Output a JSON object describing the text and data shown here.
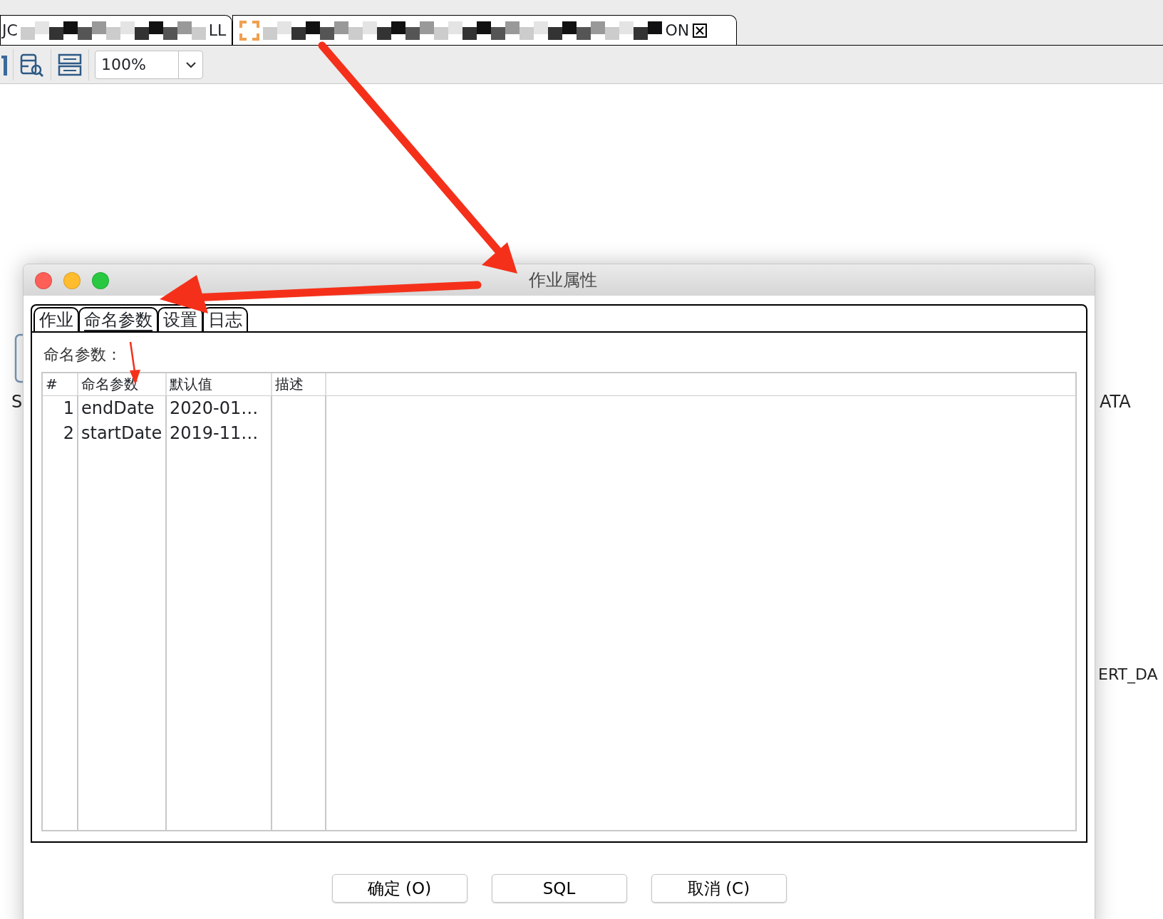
{
  "editor_tabs": [
    {
      "label_start": "JC",
      "label_end": "LL"
    },
    {
      "label_end": "ON"
    }
  ],
  "toolbar": {
    "zoom": "100%"
  },
  "canvas_labels": [
    "S",
    "ATA",
    "ERT_DA"
  ],
  "dialog": {
    "title": "作业属性",
    "tabs": [
      {
        "label": "作业",
        "selected": false
      },
      {
        "label": "命名参数",
        "selected": true
      },
      {
        "label": "设置",
        "selected": false
      },
      {
        "label": "日志",
        "selected": false
      }
    ],
    "section_label": "命名参数：",
    "table": {
      "columns": [
        "#",
        "命名参数",
        "默认值",
        "描述"
      ],
      "rows": [
        [
          "1",
          "endDate",
          "2020-01…"
        ],
        [
          "2",
          "startDate",
          "2019-11…"
        ]
      ]
    },
    "buttons": [
      "确定 (O)",
      "SQL",
      "取消 (C)"
    ]
  }
}
